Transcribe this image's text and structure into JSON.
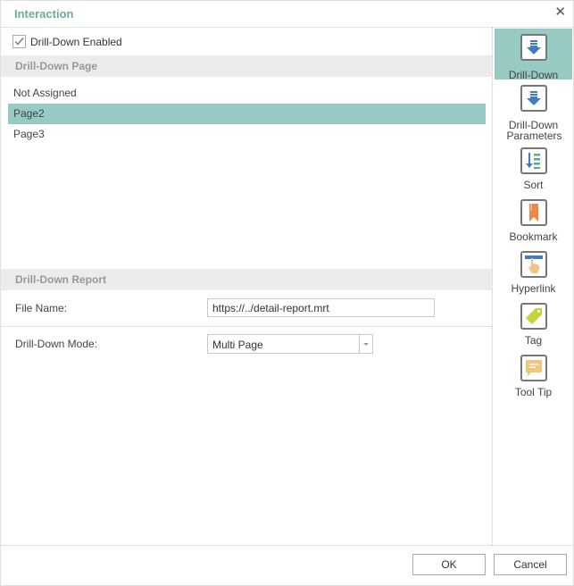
{
  "dialog": {
    "title": "Interaction",
    "close_glyph": "✕"
  },
  "drill_down_enabled": {
    "label": "Drill-Down Enabled",
    "checked": true
  },
  "drill_down_page": {
    "header": "Drill-Down Page",
    "items": [
      {
        "label": "Not Assigned",
        "selected": false
      },
      {
        "label": "Page2",
        "selected": true
      },
      {
        "label": "Page3",
        "selected": false
      }
    ]
  },
  "drill_down_report": {
    "header": "Drill-Down Report",
    "file_name_label": "File Name:",
    "file_name_value": "https://../detail-report.mrt",
    "mode_label": "Drill-Down Mode:",
    "mode_value": "Multi Page"
  },
  "sidebar": {
    "items": [
      {
        "label": "Drill-Down",
        "icon": "drill-down-icon",
        "active": true
      },
      {
        "label": "Drill-Down Parameters",
        "icon": "drill-down-parameters-icon",
        "active": false
      },
      {
        "label": "Sort",
        "icon": "sort-icon",
        "active": false
      },
      {
        "label": "Bookmark",
        "icon": "bookmark-icon",
        "active": false
      },
      {
        "label": "Hyperlink",
        "icon": "hyperlink-icon",
        "active": false
      },
      {
        "label": "Tag",
        "icon": "tag-icon",
        "active": false
      },
      {
        "label": "Tool Tip",
        "icon": "tooltip-icon",
        "active": false
      }
    ]
  },
  "footer": {
    "ok_label": "OK",
    "cancel_label": "Cancel"
  },
  "colors": {
    "accent": "#98cac4",
    "title": "#6fa8a0"
  }
}
